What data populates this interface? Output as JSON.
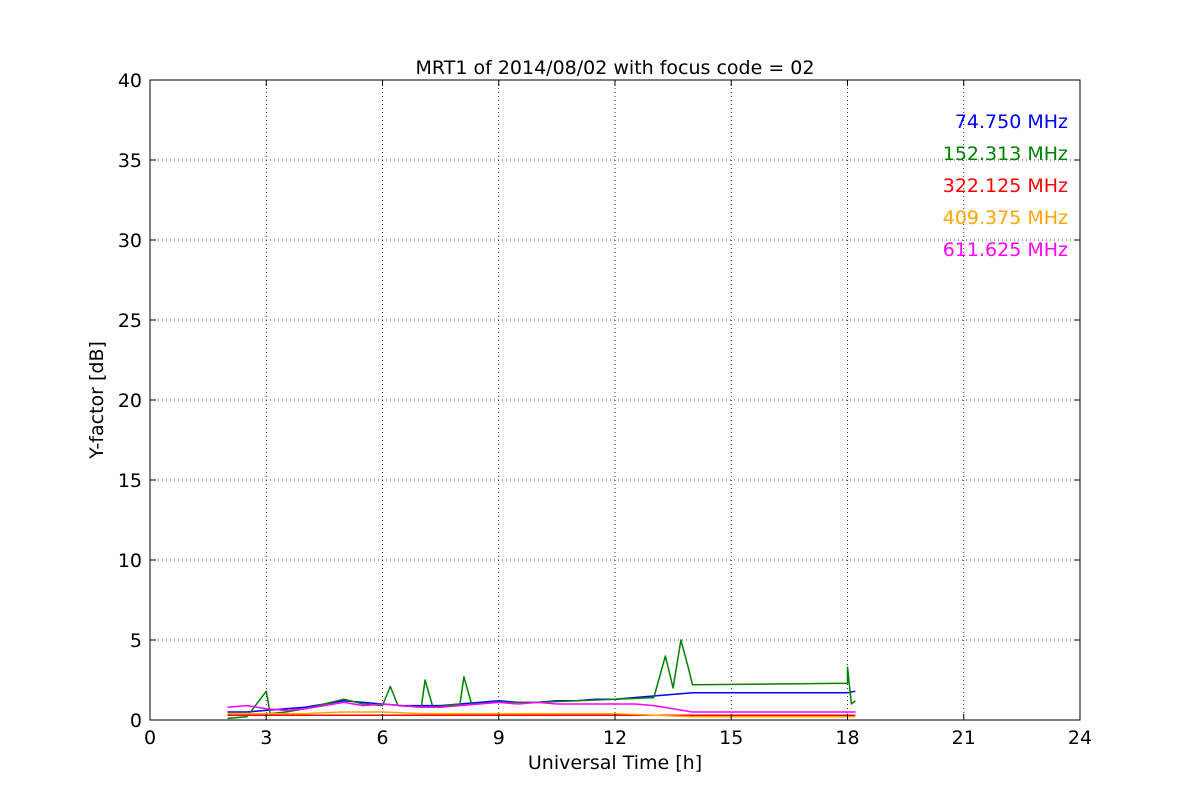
{
  "chart_data": {
    "type": "line",
    "title": "MRT1 of 2014/08/02 with focus code = 02",
    "xlabel": "Universal Time [h]",
    "ylabel": "Y-factor [dB]",
    "xlim": [
      0,
      24
    ],
    "ylim": [
      0,
      40
    ],
    "xticks": [
      0,
      3,
      6,
      9,
      12,
      15,
      18,
      21,
      24
    ],
    "yticks": [
      0,
      5,
      10,
      15,
      20,
      25,
      30,
      35,
      40
    ],
    "grid": true,
    "legend": "top-right",
    "series": [
      {
        "name": "74.750 MHz",
        "color": "#0000ff",
        "points": [
          [
            2.0,
            0.5
          ],
          [
            2.5,
            0.5
          ],
          [
            3.0,
            0.6
          ],
          [
            3.5,
            0.7
          ],
          [
            4.0,
            0.8
          ],
          [
            4.5,
            1.0
          ],
          [
            5.0,
            1.2
          ],
          [
            5.5,
            1.1
          ],
          [
            6.0,
            1.0
          ],
          [
            6.5,
            0.9
          ],
          [
            7.0,
            0.9
          ],
          [
            7.5,
            0.9
          ],
          [
            8.0,
            1.0
          ],
          [
            8.5,
            1.1
          ],
          [
            9.0,
            1.2
          ],
          [
            9.5,
            1.1
          ],
          [
            10.0,
            1.1
          ],
          [
            10.5,
            1.2
          ],
          [
            11.0,
            1.2
          ],
          [
            11.5,
            1.3
          ],
          [
            12.0,
            1.3
          ],
          [
            12.5,
            1.4
          ],
          [
            13.0,
            1.5
          ],
          [
            13.5,
            1.6
          ],
          [
            14.0,
            1.7
          ],
          [
            18.0,
            1.7
          ],
          [
            18.2,
            1.8
          ]
        ]
      },
      {
        "name": "152.313 MHz",
        "color": "#008000",
        "points": [
          [
            2.0,
            0.1
          ],
          [
            2.5,
            0.2
          ],
          [
            3.0,
            1.8
          ],
          [
            3.1,
            0.4
          ],
          [
            3.5,
            0.5
          ],
          [
            4.0,
            0.7
          ],
          [
            4.5,
            1.0
          ],
          [
            5.0,
            1.3
          ],
          [
            5.5,
            1.0
          ],
          [
            6.0,
            0.9
          ],
          [
            6.2,
            2.1
          ],
          [
            6.4,
            0.9
          ],
          [
            7.0,
            0.8
          ],
          [
            7.1,
            2.5
          ],
          [
            7.3,
            0.8
          ],
          [
            8.0,
            1.0
          ],
          [
            8.1,
            2.7
          ],
          [
            8.3,
            1.0
          ],
          [
            9.0,
            1.1
          ],
          [
            10.0,
            1.1
          ],
          [
            11.0,
            1.2
          ],
          [
            12.0,
            1.3
          ],
          [
            13.0,
            1.4
          ],
          [
            13.3,
            4.0
          ],
          [
            13.5,
            2.0
          ],
          [
            13.7,
            5.0
          ],
          [
            13.9,
            3.2
          ],
          [
            14.0,
            2.2
          ],
          [
            18.0,
            2.3
          ],
          [
            18.0,
            3.3
          ],
          [
            18.1,
            1.0
          ],
          [
            18.2,
            1.2
          ]
        ]
      },
      {
        "name": "322.125 MHz",
        "color": "#ff0000",
        "points": [
          [
            2.0,
            0.3
          ],
          [
            3.0,
            0.3
          ],
          [
            4.0,
            0.3
          ],
          [
            5.0,
            0.3
          ],
          [
            6.0,
            0.3
          ],
          [
            7.0,
            0.3
          ],
          [
            8.0,
            0.3
          ],
          [
            9.0,
            0.3
          ],
          [
            10.0,
            0.3
          ],
          [
            11.0,
            0.3
          ],
          [
            12.0,
            0.3
          ],
          [
            13.0,
            0.3
          ],
          [
            14.0,
            0.3
          ],
          [
            18.0,
            0.3
          ],
          [
            18.2,
            0.3
          ]
        ]
      },
      {
        "name": "409.375 MHz",
        "color": "#ffa500",
        "points": [
          [
            2.0,
            0.4
          ],
          [
            3.0,
            0.4
          ],
          [
            4.0,
            0.4
          ],
          [
            5.0,
            0.5
          ],
          [
            6.0,
            0.5
          ],
          [
            7.0,
            0.4
          ],
          [
            8.0,
            0.4
          ],
          [
            9.0,
            0.4
          ],
          [
            10.0,
            0.4
          ],
          [
            11.0,
            0.4
          ],
          [
            12.0,
            0.4
          ],
          [
            13.0,
            0.3
          ],
          [
            14.0,
            0.2
          ],
          [
            18.0,
            0.2
          ],
          [
            18.2,
            0.2
          ]
        ]
      },
      {
        "name": "611.625 MHz",
        "color": "#ff00ff",
        "points": [
          [
            2.0,
            0.8
          ],
          [
            2.5,
            0.9
          ],
          [
            3.0,
            0.7
          ],
          [
            3.5,
            0.6
          ],
          [
            4.0,
            0.7
          ],
          [
            4.5,
            0.9
          ],
          [
            5.0,
            1.1
          ],
          [
            5.5,
            0.9
          ],
          [
            6.0,
            1.0
          ],
          [
            6.5,
            0.9
          ],
          [
            7.0,
            0.8
          ],
          [
            7.5,
            0.8
          ],
          [
            8.0,
            0.9
          ],
          [
            8.5,
            1.0
          ],
          [
            9.0,
            1.1
          ],
          [
            9.5,
            1.0
          ],
          [
            10.0,
            1.1
          ],
          [
            10.5,
            1.0
          ],
          [
            11.0,
            1.0
          ],
          [
            11.5,
            1.0
          ],
          [
            12.0,
            1.0
          ],
          [
            12.5,
            1.0
          ],
          [
            13.0,
            0.9
          ],
          [
            13.5,
            0.7
          ],
          [
            14.0,
            0.5
          ],
          [
            18.0,
            0.5
          ],
          [
            18.2,
            0.5
          ]
        ]
      }
    ]
  }
}
